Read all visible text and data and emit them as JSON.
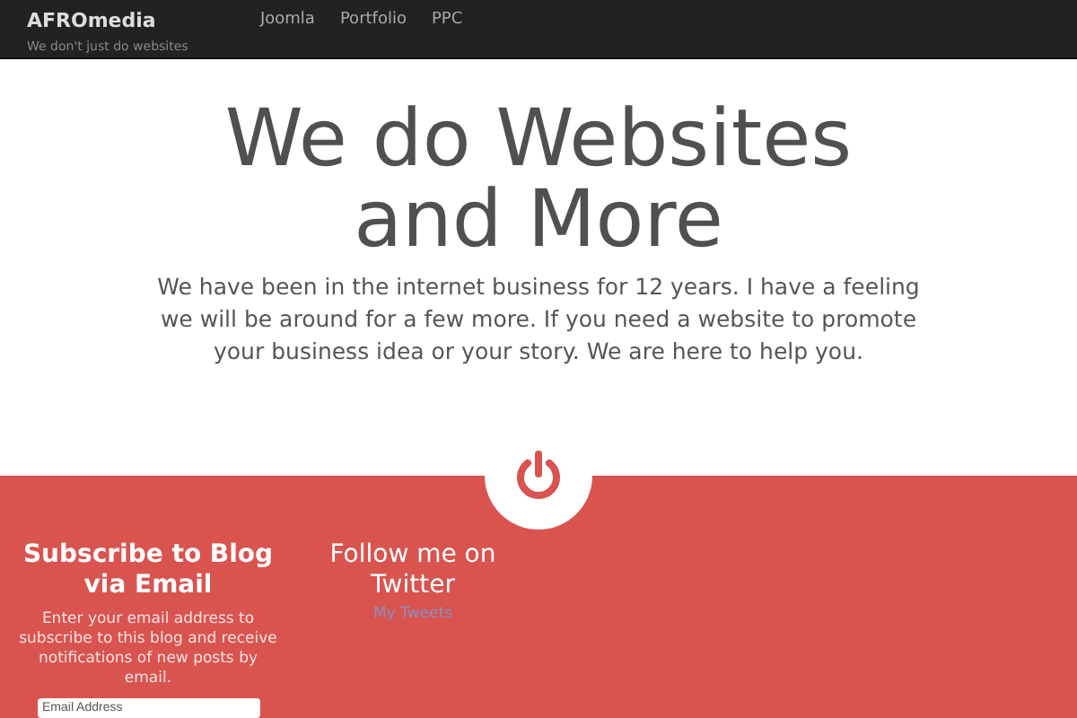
{
  "navbar": {
    "brand": "AFROmedia",
    "tagline": "We don't just do websites",
    "links": [
      {
        "label": "Joomla"
      },
      {
        "label": "Portfolio"
      },
      {
        "label": "PPC"
      }
    ]
  },
  "hero": {
    "title_lines": [
      "We do Websites",
      "and More"
    ],
    "text": "We have been in the internet business for 12 years. I have a feeling we will be around for a few more. If you need a website to promote your business idea or your story. We are here to help you."
  },
  "subscribe": {
    "title": "Subscribe to Blog via Email",
    "text": "Enter your email address to subscribe to this blog and receive notifications of new posts by email.",
    "email_field": {
      "placeholder": "Email Address"
    }
  },
  "twitter": {
    "title": "Follow me on Twitter",
    "link": "My Tweets"
  }
}
